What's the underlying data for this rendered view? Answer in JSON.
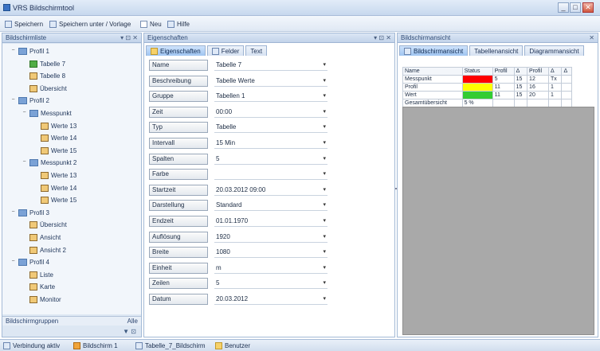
{
  "window": {
    "title": "VRS Bildschirmtool",
    "buttons": {
      "minimize": "_",
      "maximize": "□",
      "close": "✕"
    }
  },
  "toolbar": {
    "items": [
      {
        "label": "Speichern",
        "icon": "save-icon"
      },
      {
        "label": "Speichern unter / Vorlage",
        "icon": "save-as-icon"
      },
      {
        "label": "Neu",
        "icon": "new-icon"
      },
      {
        "label": "Hilfe",
        "icon": "help-icon"
      }
    ]
  },
  "left_pane": {
    "title": "Bildschirmliste",
    "pin": "▾ ⊡ ✕",
    "tree": [
      {
        "label": "Profil 1",
        "level": 0,
        "type": "folder",
        "expander": "−"
      },
      {
        "label": "Tabelle 7",
        "level": 1,
        "type": "item-green"
      },
      {
        "label": "Tabelle 8",
        "level": 1,
        "type": "item"
      },
      {
        "label": "Übersicht",
        "level": 1,
        "type": "item"
      },
      {
        "label": "Profil 2",
        "level": 0,
        "type": "folder",
        "expander": "−"
      },
      {
        "label": "Messpunkt",
        "level": 1,
        "type": "folder",
        "expander": "−"
      },
      {
        "label": "Werte 13",
        "level": 2,
        "type": "item"
      },
      {
        "label": "Werte 14",
        "level": 2,
        "type": "item"
      },
      {
        "label": "Werte 15",
        "level": 2,
        "type": "item"
      },
      {
        "label": "Messpunkt 2",
        "level": 1,
        "type": "folder",
        "expander": "−"
      },
      {
        "label": "Werte 13",
        "level": 2,
        "type": "item"
      },
      {
        "label": "Werte 14",
        "level": 2,
        "type": "item"
      },
      {
        "label": "Werte 15",
        "level": 2,
        "type": "item"
      },
      {
        "label": "Profil 3",
        "level": 0,
        "type": "folder",
        "expander": "−"
      },
      {
        "label": "Übersicht",
        "level": 1,
        "type": "item"
      },
      {
        "label": "Ansicht",
        "level": 1,
        "type": "item"
      },
      {
        "label": "Ansicht 2",
        "level": 1,
        "type": "item"
      },
      {
        "label": "Profil 4",
        "level": 0,
        "type": "folder",
        "expander": "−"
      },
      {
        "label": "Liste",
        "level": 1,
        "type": "item"
      },
      {
        "label": "Karte",
        "level": 1,
        "type": "item"
      },
      {
        "label": "Monitor",
        "level": 1,
        "type": "item"
      }
    ],
    "footer_label": "Bildschirmgruppen",
    "footer_value": "Alle",
    "footer_controls": "▼ ⊡"
  },
  "mid_pane": {
    "title": "Eigenschaften",
    "pin": "▾ ⊡ ✕",
    "tabs": [
      {
        "label": "Eigenschaften",
        "active": true
      },
      {
        "label": "Felder",
        "active": false
      },
      {
        "label": "Text",
        "active": false
      }
    ],
    "properties": [
      {
        "label": "Name",
        "value": "Tabelle 7",
        "drop": "▾"
      },
      {
        "label": "Beschreibung",
        "value": "Tabelle Werte",
        "drop": "▾"
      },
      {
        "label": "Gruppe",
        "value": "Tabellen 1",
        "drop": "▾"
      },
      {
        "label": "Zeit",
        "value": "00:00",
        "drop": "▾"
      },
      {
        "label": "Typ",
        "value": "Tabelle",
        "drop": "▾"
      },
      {
        "label": "Intervall",
        "value": "15 Min",
        "drop": "▾"
      },
      {
        "label": "Spalten",
        "value": "5",
        "drop": "▾"
      },
      {
        "label": "Farbe",
        "value": "",
        "drop": "▾"
      },
      {
        "label": "Startzeit",
        "value": "20.03.2012 09:00",
        "drop": "▾"
      },
      {
        "label": "Darstellung",
        "value": "Standard",
        "drop": "▾"
      },
      {
        "label": "Endzeit",
        "value": "01.01.1970",
        "drop": "▾"
      },
      {
        "label": "Auflösung",
        "value": "1920",
        "drop": "▾"
      },
      {
        "label": "Breite",
        "value": "1080",
        "drop": "▾"
      },
      {
        "label": "Einheit",
        "value": "m",
        "drop": "▾"
      },
      {
        "label": "Zeilen",
        "value": "5",
        "drop": "▾"
      },
      {
        "label": "Datum",
        "value": "20.03.2012",
        "drop": "▾"
      }
    ]
  },
  "right_pane": {
    "title": "Bildschirmansicht",
    "pin": "✕",
    "tabs": [
      {
        "label": "Bildschirmansicht",
        "active": true
      },
      {
        "label": "Tabellenansicht",
        "active": false
      },
      {
        "label": "Diagrammansicht",
        "active": false
      }
    ],
    "table": {
      "headers": [
        "Name",
        "Status",
        "Profil",
        "Δ",
        "Profil",
        "Δ",
        "Δ"
      ],
      "rows": [
        {
          "name": "Messpunkt",
          "color": "#ff0000",
          "cells": [
            "5",
            "15",
            "12",
            "Tx"
          ]
        },
        {
          "name": "Profil",
          "color": "#ffff00",
          "cells": [
            "11",
            "15",
            "16",
            "1"
          ]
        },
        {
          "name": "Wert",
          "color": "#33cc33",
          "cells": [
            "11",
            "15",
            "20",
            "1"
          ]
        },
        {
          "name": "Gesamtübersicht",
          "color": "#ffffff",
          "status_text": "5 %",
          "cells": [
            "",
            "",
            "",
            ""
          ]
        }
      ]
    }
  },
  "statusbar": {
    "items": [
      {
        "label": "Verbindung aktiv"
      },
      {
        "label": "Bildschirm 1"
      },
      {
        "label": "Tabelle_7_Bildschirm"
      },
      {
        "label": "Benutzer"
      }
    ]
  }
}
